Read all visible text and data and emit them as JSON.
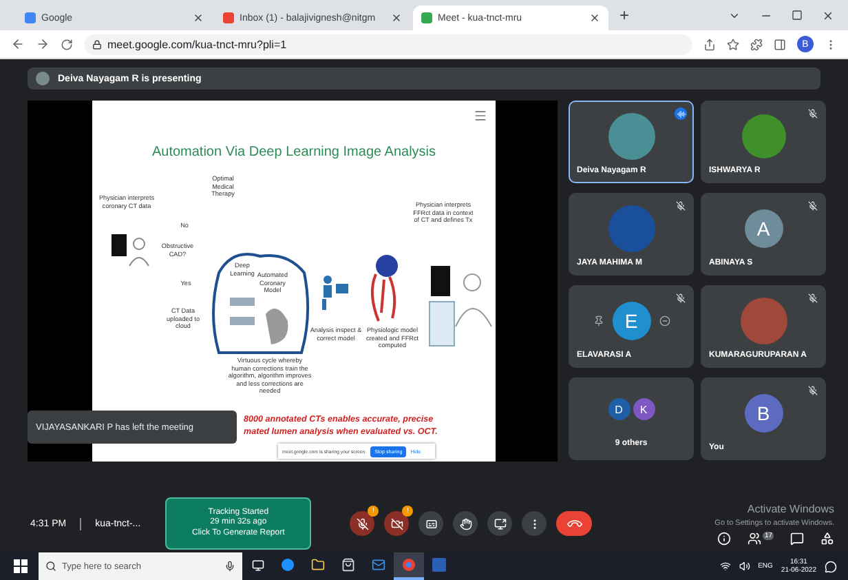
{
  "browser": {
    "tabs": [
      {
        "label": "Google",
        "selected": false
      },
      {
        "label": "Inbox (1) - balajivignesh@nitgm",
        "selected": false
      },
      {
        "label": "Meet - kua-tnct-mru",
        "selected": true
      }
    ],
    "new_tab": "+",
    "url": "meet.google.com/kua-tnct-mru?pli=1",
    "profile": "B"
  },
  "presenting_banner": "Deiva Nayagam R is presenting",
  "slide": {
    "title": "Automation Via Deep Learning Image Analysis",
    "labels": [
      {
        "text": "Physician interprets coronary CT data",
        "kind": "left1"
      },
      {
        "text": "Optimal Medical Therapy",
        "kind": "top"
      },
      {
        "text": "No",
        "kind": "no"
      },
      {
        "text": "Obstructive CAD?",
        "kind": "cad"
      },
      {
        "text": "Yes",
        "kind": "yes"
      },
      {
        "text": "CT Data uploaded to cloud",
        "kind": "upload"
      },
      {
        "text": "Deep Learning",
        "kind": "deep"
      },
      {
        "text": "Automated Coronary Model",
        "kind": "auto"
      },
      {
        "text": "Analysis inspect & correct model",
        "kind": "inspect"
      },
      {
        "text": "Physiologic model created and FFRct computed",
        "kind": "physio"
      },
      {
        "text": "Physician interprets FFRct data in context of CT and defines Tx",
        "kind": "right"
      },
      {
        "text": "Virtuous cycle whereby human corrections train the algorithm, algorithm improves and less corrections are needed",
        "kind": "cycle"
      }
    ],
    "highlight": [
      "8000 annotated CTs enables accurate, precise",
      "mated lumen analysis when evaluated vs. OCT."
    ],
    "share_bar": {
      "text": "meet.google.com is sharing your screen.",
      "stop": "Stop sharing",
      "hide": "Hide"
    }
  },
  "toast": "VIJAYASANKARI P has left the meeting",
  "participants": [
    {
      "name": "Deiva Nayagam R",
      "kind": "photo",
      "color": "#4a8f95",
      "selected": true,
      "muted": false
    },
    {
      "name": "ISHWARYA R",
      "kind": "smiley",
      "color": "#3f8f2a",
      "selected": false,
      "muted": true
    },
    {
      "name": "JAYA MAHIMA M",
      "kind": "photo",
      "color": "#1a4f9c",
      "selected": false,
      "muted": true
    },
    {
      "name": "ABINAYA S",
      "kind": "letter",
      "letter": "A",
      "color": "#6f8c9a",
      "selected": false,
      "muted": true
    },
    {
      "name": "ELAVARASI A",
      "kind": "hover",
      "letter": "E",
      "color": "#1f8fd0",
      "selected": false,
      "muted": true
    },
    {
      "name": "KUMARAGURUPARAN A",
      "kind": "photo",
      "color": "#a0483a",
      "selected": false,
      "muted": true
    },
    {
      "name": "9 others",
      "kind": "group",
      "avatars": [
        {
          "letter": "D",
          "color": "#1e5fa8"
        },
        {
          "letter": "K",
          "color": "#7e57c2"
        }
      ],
      "selected": false,
      "muted": false
    },
    {
      "name": "You",
      "kind": "letter",
      "letter": "B",
      "color": "#5c6bc0",
      "selected": false,
      "muted": true
    }
  ],
  "bottom": {
    "time": "4:31 PM",
    "meeting": "kua-tnct-...",
    "tracking": [
      "Tracking Started",
      "29 min 32s ago",
      "Click To Generate Report"
    ],
    "controls": [
      {
        "kind": "mic",
        "alert": "!"
      },
      {
        "kind": "cam",
        "alert": "!"
      },
      {
        "kind": "cc"
      },
      {
        "kind": "hand"
      },
      {
        "kind": "present"
      },
      {
        "kind": "more"
      },
      {
        "kind": "end"
      }
    ],
    "people_count": "17",
    "activate": [
      "Activate Windows",
      "Go to Settings to activate Windows."
    ]
  },
  "taskbar": {
    "search_placeholder": "Type here to search",
    "apps": [
      {
        "kind": "edge",
        "selected": false
      },
      {
        "kind": "folder",
        "selected": false
      },
      {
        "kind": "store",
        "selected": false
      },
      {
        "kind": "mail",
        "selected": false
      },
      {
        "kind": "chrome",
        "selected": true
      },
      {
        "kind": "word",
        "selected": false
      }
    ],
    "lang": "ENG",
    "clock": "16:31",
    "date": "21-06-2022"
  }
}
